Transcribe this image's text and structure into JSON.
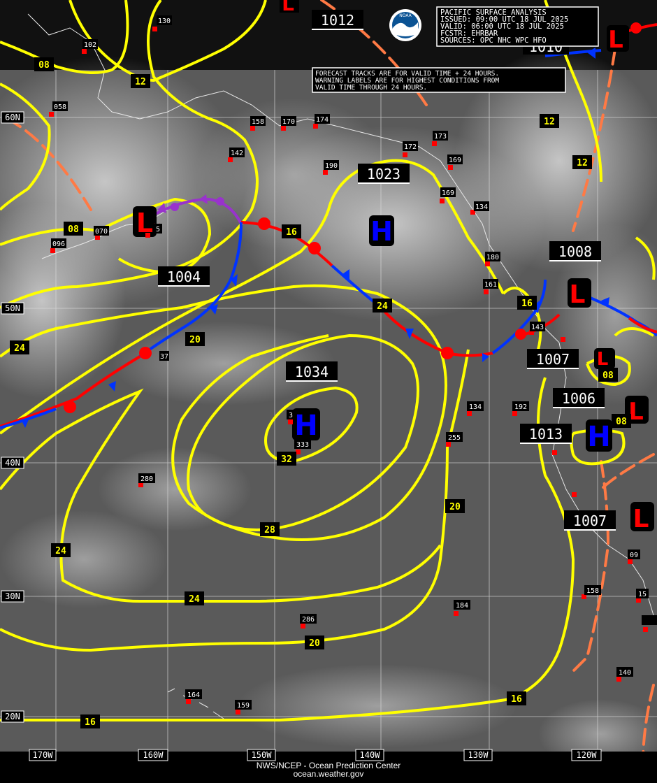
{
  "header": {
    "title": "PACIFIC SURFACE ANALYSIS",
    "issued": "ISSUED: 09:00 UTC 18 JUL 2025",
    "valid": "VALID:  06:00 UTC 18 JUL 2025",
    "forecaster": "FCSTR:  EHRBAR",
    "sources": "SOURCES: OPC NHC WPC HFO",
    "logo_text": "NOAA"
  },
  "note": {
    "line1": "FORECAST TRACKS ARE FOR VALID TIME + 24 HOURS.",
    "line2": "WARNING LABELS ARE FOR HIGHEST CONDITIONS FROM",
    "line3": "VALID TIME THROUGH 24 HOURS."
  },
  "footer": {
    "line1": "NWS/NCEP - Ocean Prediction Center",
    "line2": "ocean.weather.gov"
  },
  "lat_labels": [
    "60N",
    "50N",
    "40N",
    "30N",
    "20N"
  ],
  "lon_labels": [
    "170W",
    "160W",
    "150W",
    "140W",
    "130W",
    "120W"
  ],
  "pressure_labels": [
    "1012",
    "1010",
    "1023",
    "1008",
    "1004",
    "1034",
    "1007",
    "1006",
    "1013",
    "1007"
  ],
  "isobar_labels": [
    "08",
    "12",
    "08",
    "16",
    "24",
    "12",
    "16",
    "12",
    "20",
    "24",
    "28",
    "32",
    "20",
    "24",
    "08",
    "08",
    "24",
    "20",
    "16",
    "16"
  ],
  "station_labels": [
    "130",
    "102",
    "058",
    "158",
    "170",
    "174",
    "142",
    "190",
    "173",
    "172",
    "169",
    "169",
    "134",
    "070",
    "096",
    "180",
    "161",
    "143",
    "192",
    "134",
    "255",
    "280",
    "333",
    "184",
    "286",
    "164",
    "159",
    "158",
    "140",
    "09",
    "15",
    "3",
    "5",
    "37"
  ],
  "centers": {
    "high_symbol": "H",
    "low_symbol": "L"
  },
  "colors": {
    "background": "#5a5a5a",
    "isobar": "#ffff00",
    "warm_front": "#ff0000",
    "cold_front": "#0033ff",
    "occluded_front": "#9933cc",
    "trough": "#ff7a45",
    "high_center": "#0000ff",
    "low_center": "#ff0000",
    "station": "#ff0000"
  }
}
